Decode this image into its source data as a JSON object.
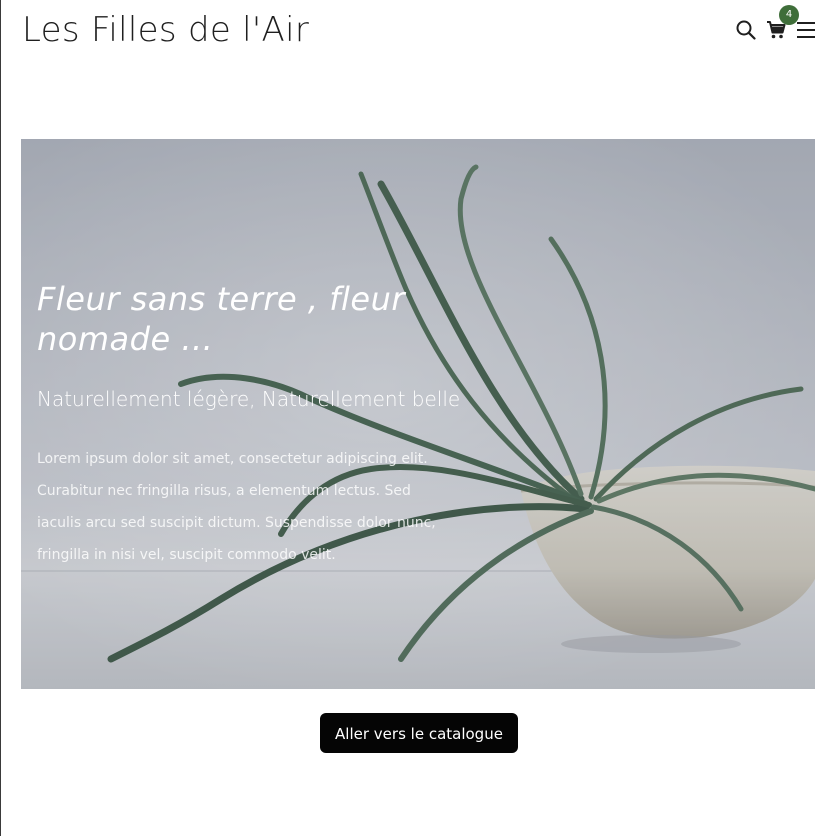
{
  "header": {
    "brand": "Les Filles de l'Air",
    "cart_count": "4",
    "icons": [
      "search-icon",
      "cart-icon",
      "menu-icon"
    ]
  },
  "hero": {
    "title": "Fleur sans terre , fleur nomade ...",
    "subtitle": "Naturellement légère, Naturellement belle",
    "body": "Lorem ipsum dolor sit amet, consectetur adipiscing elit. Curabitur nec fringilla risus, a elementum lectus. Sed iaculis arcu sed suscipit dictum. Suspendisse dolor nunc, fringilla in nisi vel, suscipit commodo velit."
  },
  "cta": {
    "label": "Aller vers le catalogue"
  },
  "colors": {
    "badge": "#3f6e3a",
    "button": "#050505"
  }
}
